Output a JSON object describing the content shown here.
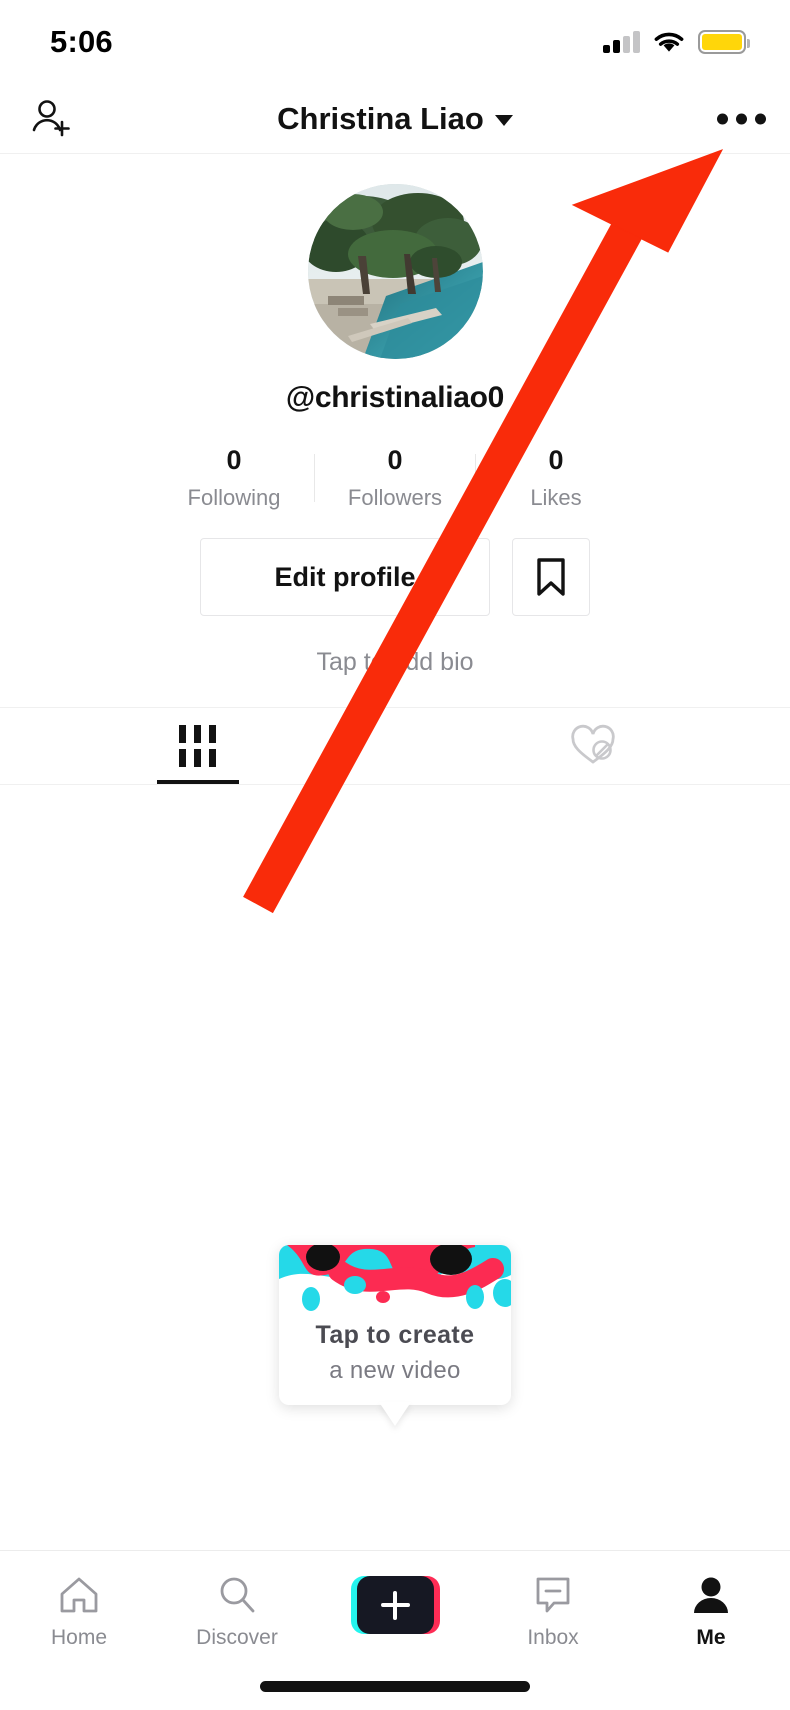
{
  "status_bar": {
    "time": "5:06",
    "cell_icon": "cellular-bars-icon",
    "wifi_icon": "wifi-icon",
    "battery_icon": "battery-icon",
    "battery_color": "#ffd60a"
  },
  "header": {
    "add_friends_icon": "add-person-icon",
    "title": "Christina Liao",
    "dropdown_icon": "chevron-down-icon",
    "more_icon": "more-options-icon"
  },
  "profile": {
    "avatar_icon": "avatar-image",
    "username": "@christinaliao0",
    "stats": [
      {
        "value": "0",
        "label": "Following"
      },
      {
        "value": "0",
        "label": "Followers"
      },
      {
        "value": "0",
        "label": "Likes"
      }
    ],
    "edit_profile_label": "Edit profile",
    "bookmark_icon": "bookmark-icon",
    "bio_placeholder": "Tap to add bio"
  },
  "tabs": [
    {
      "icon": "grid-posts-icon",
      "active": true
    },
    {
      "icon": "private-liked-heart-icon",
      "active": false
    }
  ],
  "create_tooltip": {
    "line1": "Tap to create",
    "line2": "a new video",
    "art_icon": "tiktok-blob-art",
    "colors": {
      "cyan": "#25d9e8",
      "pink": "#fc2b52",
      "black": "#111111"
    }
  },
  "bottom_nav": {
    "items": [
      {
        "label": "Home",
        "icon": "home-icon",
        "active": false
      },
      {
        "label": "Discover",
        "icon": "search-icon",
        "active": false
      },
      {
        "label": "",
        "icon": "create-video-icon",
        "active": false
      },
      {
        "label": "Inbox",
        "icon": "inbox-message-icon",
        "active": false
      },
      {
        "label": "Me",
        "icon": "person-icon",
        "active": true
      }
    ],
    "home_indicator_icon": "home-indicator"
  },
  "annotation": {
    "arrow_icon": "red-pointer-arrow",
    "arrow_color": "#f92b0a",
    "points_to": "more-options-icon"
  }
}
